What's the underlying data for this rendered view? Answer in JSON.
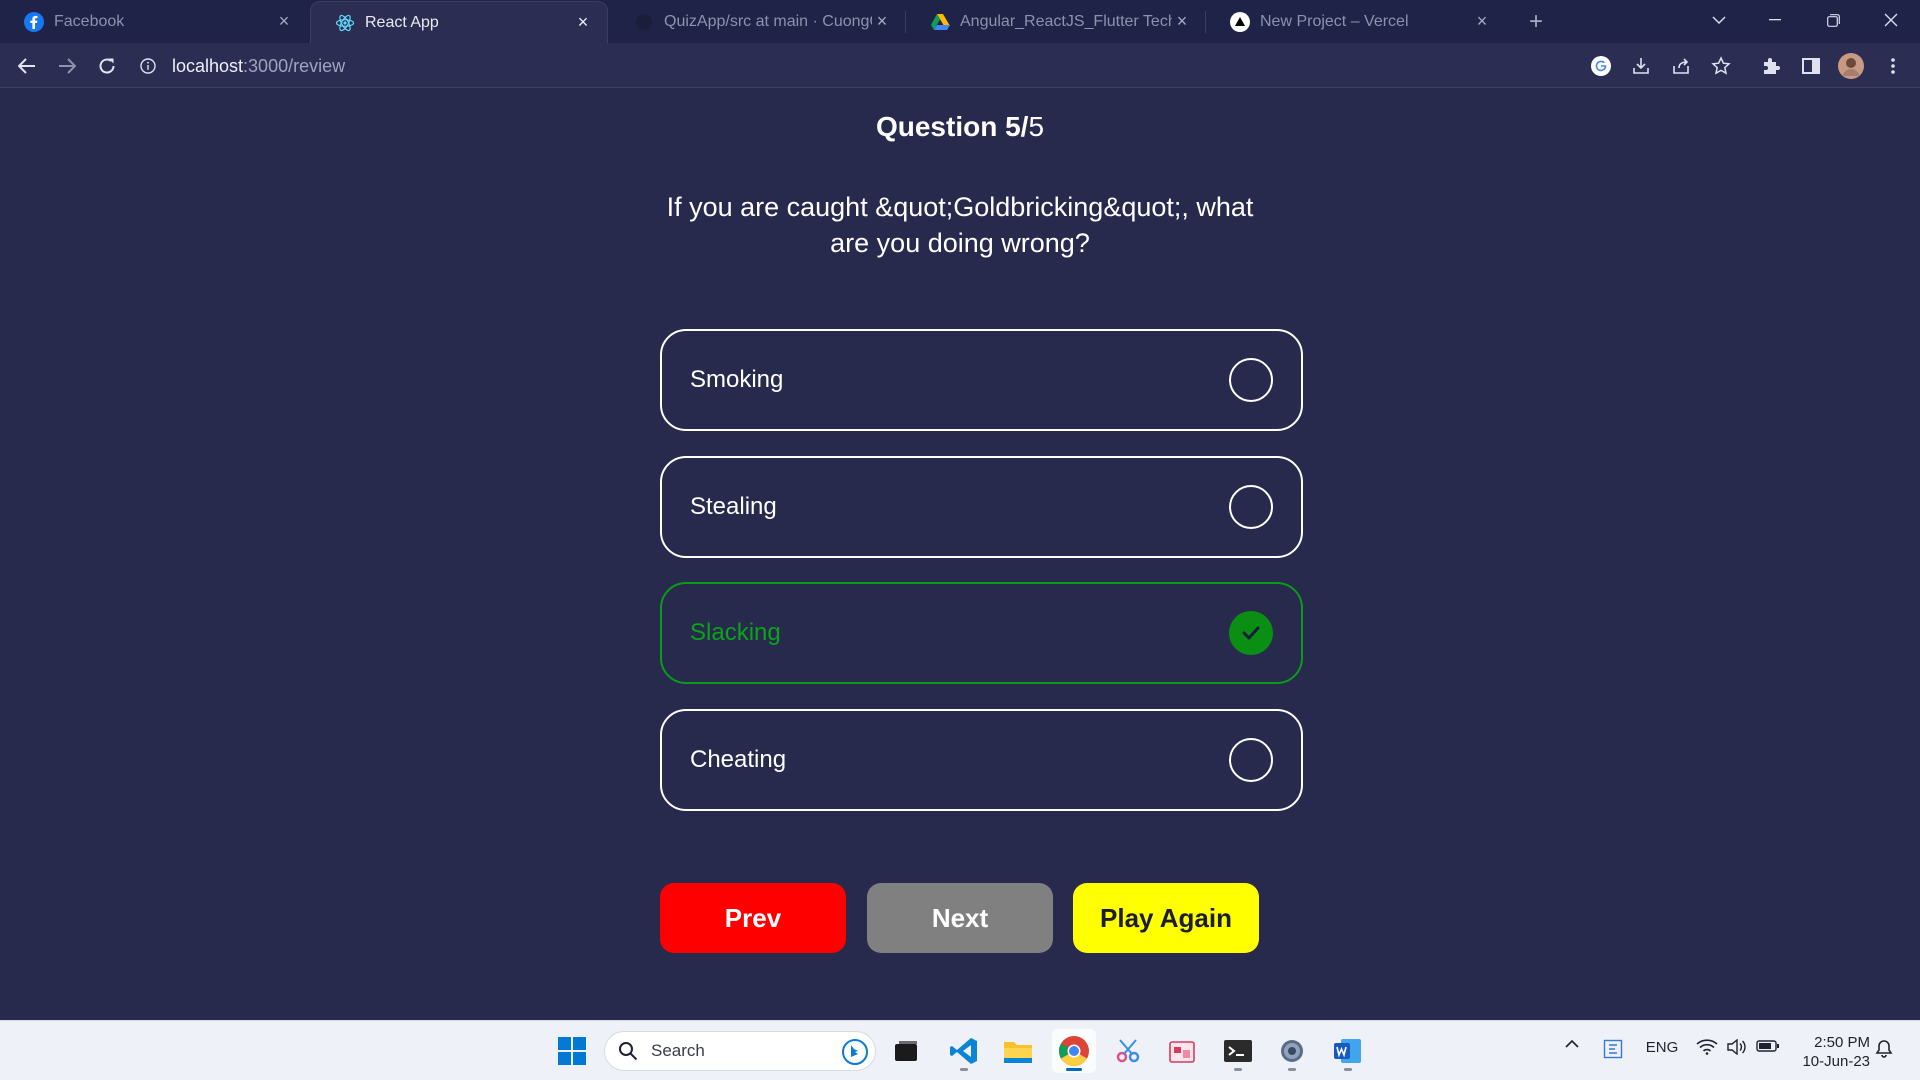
{
  "browser": {
    "tabs": [
      {
        "label": "Facebook",
        "icon": "facebook-icon",
        "active": false
      },
      {
        "label": "React App",
        "icon": "react-icon",
        "active": true
      },
      {
        "label": "QuizApp/src at main · CuongGo",
        "icon": "github-icon",
        "active": false
      },
      {
        "label": "Angular_ReactJS_Flutter Technica",
        "icon": "google-drive-icon",
        "active": false
      },
      {
        "label": "New Project – Vercel",
        "icon": "vercel-icon",
        "active": false
      }
    ],
    "url_host": "localhost",
    "url_path": ":3000/review"
  },
  "quiz": {
    "question_label": "Question 5/",
    "question_total": "5",
    "question_text": "If you are caught &quot;Goldbricking&quot;, what are you doing wrong?",
    "answers": [
      {
        "label": "Smoking",
        "state": "unselected"
      },
      {
        "label": "Stealing",
        "state": "unselected"
      },
      {
        "label": "Slacking",
        "state": "correct"
      },
      {
        "label": "Cheating",
        "state": "unselected"
      }
    ],
    "buttons": {
      "prev": "Prev",
      "next": "Next",
      "play_again": "Play Again"
    },
    "colors": {
      "background": "#272a4d",
      "correct": "#0a9b18",
      "prev": "#ff0000",
      "next": "#808080",
      "play_again": "#ffff00"
    }
  },
  "taskbar": {
    "search_placeholder": "Search",
    "language": "ENG",
    "time": "2:50 PM",
    "date": "10-Jun-23",
    "apps": [
      "windows-start-icon",
      "task-view-icon",
      "vscode-icon",
      "file-explorer-icon",
      "chrome-icon",
      "snipping-tool-icon",
      "photos-icon",
      "terminal-icon",
      "settings-icon",
      "word-icon"
    ]
  }
}
